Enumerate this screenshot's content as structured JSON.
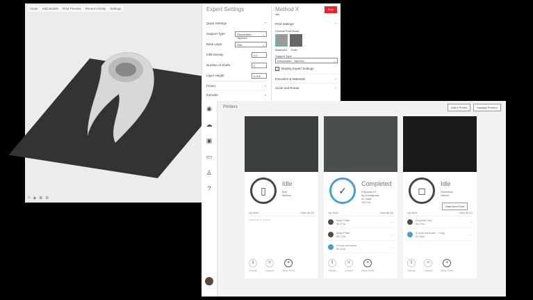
{
  "toolbar": {
    "items": [
      "Close",
      "Add Models",
      "Print Preview",
      "Recent Activity",
      "Settings"
    ]
  },
  "expert": {
    "title": "Expert Settings",
    "quick": "Quick Settings",
    "fields": [
      {
        "label": "Support Type",
        "value": "Dissolvable - Tapered"
      },
      {
        "label": "Base Layer",
        "value": "Raft"
      },
      {
        "label": "Infill Density",
        "value": "0.2"
      },
      {
        "label": "Number of Shells",
        "value": "2"
      },
      {
        "label": "Layer Height",
        "value": "0.200"
      }
    ],
    "sections": [
      "Printer",
      "Extruder"
    ]
  },
  "method": {
    "title": "Method X",
    "sub": "Idle",
    "print": "Print",
    "print_settings": "Print Settings",
    "mode_label": "Choose Print Mode",
    "modes": [
      "Balanced",
      "Solid"
    ],
    "support_label": "Support Type",
    "support_value": "Dissolvable - Tapered",
    "display_expert": "Display Expert Settings",
    "sections": [
      "Extruders & Materials",
      "Scale and Rotate"
    ]
  },
  "printers": {
    "title": "Printers",
    "add": "Add a Printer",
    "manage": "Manage Printers",
    "cards": [
      {
        "status": "Idle",
        "sub": [
          "Bolt",
          "Method"
        ],
        "upnext": "Up Next",
        "viewall": "View all (0)",
        "empty": "Nothing in Queue",
        "queue": []
      },
      {
        "status": "Completed",
        "sub": [
          "Propeller 07",
          "by prinilaposal",
          "on 34ad",
          "12h 7m"
        ],
        "upnext": "Up Next",
        "viewall": "View all (3)",
        "queue": [
          {
            "name": "Base Plate",
            "time": "3h 17m"
          },
          {
            "name": "Base Plate",
            "time": "3h 17m"
          },
          {
            "name": "5 hook minimum",
            "time": "0h 47m"
          }
        ]
      },
      {
        "status": "Idle",
        "sub": [
          "Sketchbot",
          "Sketch"
        ],
        "start": "Start Next Print",
        "upnext": "Up Next",
        "viewall": "View all (2)",
        "queue": [
          {
            "name": "Propeller Nut",
            "time": "0h 47m"
          },
          {
            "name": "5 hook minimum - Copy",
            "time": "0h 54m"
          }
        ]
      }
    ],
    "actions": [
      "Pause",
      "Cancel",
      "New Print"
    ]
  },
  "colors": {
    "accent": "#e5262a",
    "completed": "#4a9ec9"
  }
}
